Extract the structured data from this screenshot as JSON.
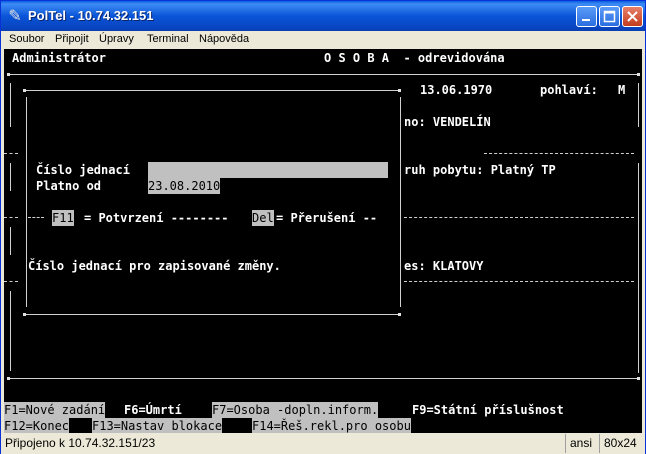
{
  "window": {
    "title": "PolTel - 10.74.32.151",
    "icon": "terminal-app-icon"
  },
  "menu": [
    "Soubor",
    "Připojit",
    "Úpravy",
    "Terminal",
    "Nápověda"
  ],
  "terminal": {
    "user": "Administrátor",
    "screen_title": "O S O B A  - odrevidována",
    "birth_date": "13.06.1970",
    "sex_label": "pohlaví:",
    "sex_value": "M",
    "name_line": "no: VENDELÍN",
    "residence_line": "ruh pobytu: Platný TP",
    "district_line": "es: KLATOVY",
    "dialog": {
      "ref_label": "Číslo jednací",
      "ref_value": "",
      "valid_label": "Platno od",
      "valid_value": "23.08.2010",
      "f11_key": "F11",
      "confirm_text": "= Potvrzení --------",
      "del_key": "Del",
      "cancel_text": "= Přerušení --",
      "hint": "Číslo jednací pro zapisované změny."
    },
    "fkeys_row1": [
      {
        "text": "F1=Nové zadání",
        "inverse": true
      },
      {
        "text": "F6=Úmrtí",
        "inverse": false
      },
      {
        "text": "F7=Osoba -dopln.inform.",
        "inverse": true
      },
      {
        "text": "F9=Státní příslušnost",
        "inverse": false
      }
    ],
    "fkeys_row2": [
      {
        "text": "F12=Konec",
        "inverse": true
      },
      {
        "text": "F13=Nastav blokace",
        "inverse": true
      },
      {
        "text": "F14=Řeš.rekl.pro osobu",
        "inverse": true
      }
    ]
  },
  "status": {
    "connection": "Připojeno k 10.74.32.151/23",
    "encoding": "ansi",
    "size": "80x24"
  }
}
